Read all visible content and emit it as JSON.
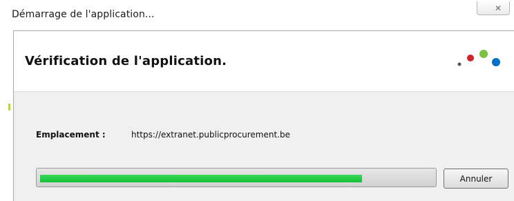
{
  "window": {
    "title": "Démarrage de l'application...",
    "close_glyph": "✕"
  },
  "header": {
    "title": "Vérification de l'application.",
    "logo_icon": "java-dots-logo-icon",
    "logo_colors": [
      "#555555",
      "#d2232a",
      "#7ac143",
      "#0072c6"
    ]
  },
  "details": {
    "location_label": "Emplacement :",
    "location_value": "https://extranet.publicprocurement.be"
  },
  "progress": {
    "value": 0.82,
    "color": "#13c137"
  },
  "buttons": {
    "cancel_label": "Annuler"
  }
}
